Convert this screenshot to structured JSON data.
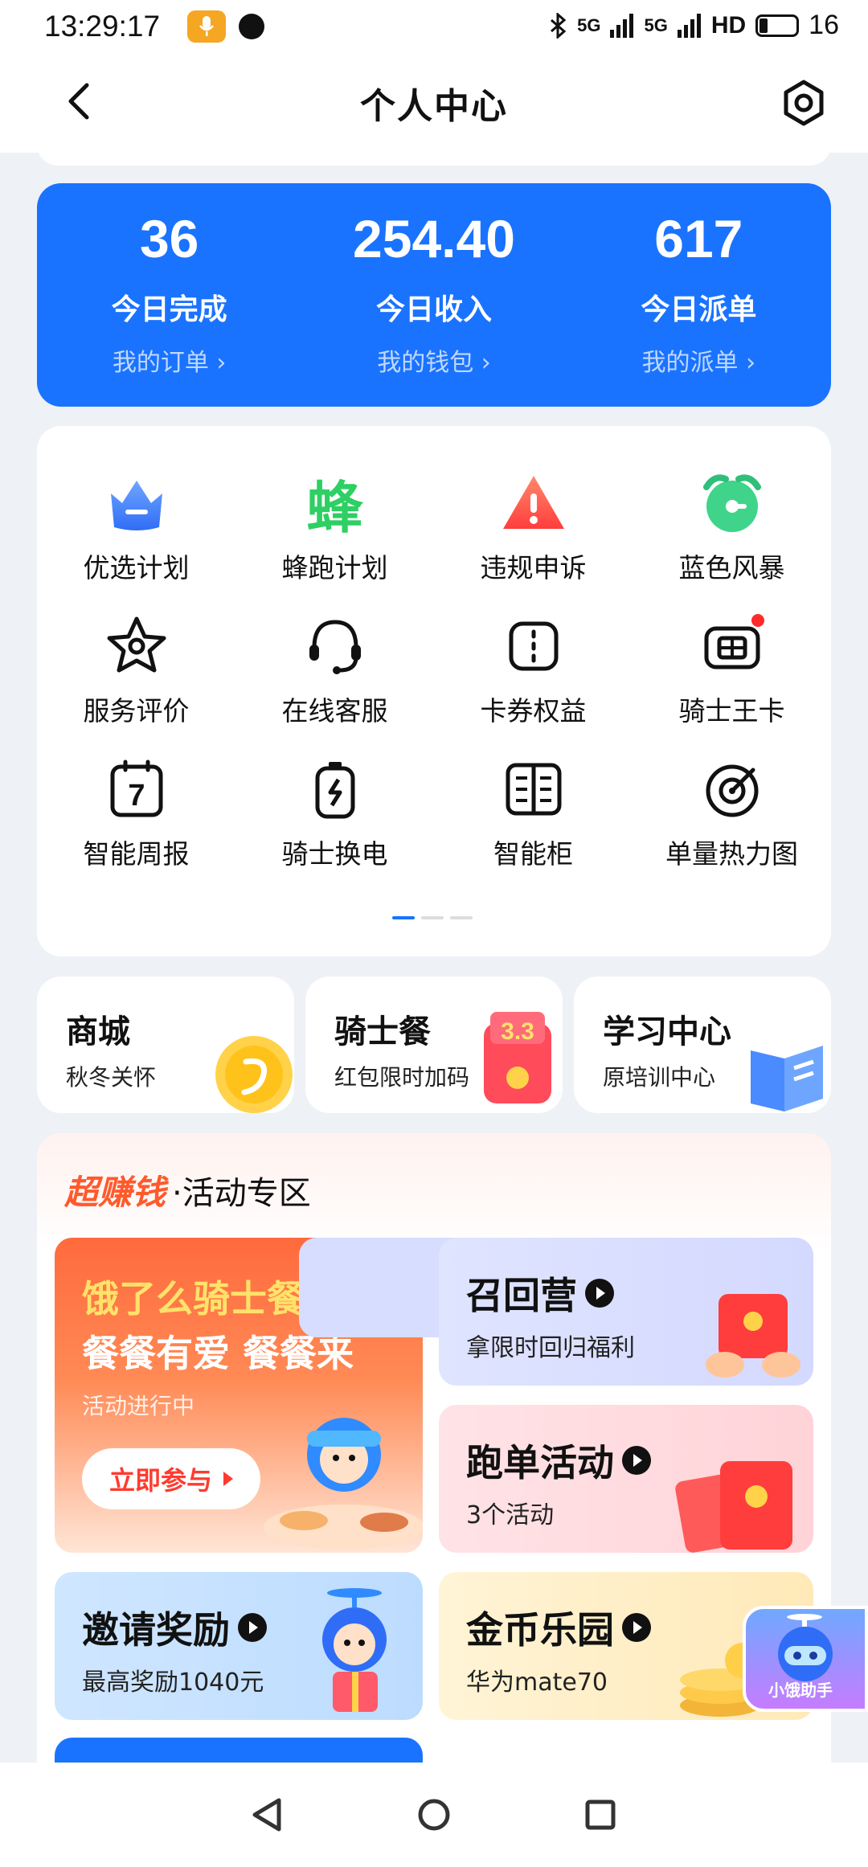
{
  "status_bar": {
    "time": "13:29:17",
    "signal1": "5G",
    "signal2": "5G",
    "hd": "HD",
    "battery": "16"
  },
  "header": {
    "title": "个人中心"
  },
  "stats": [
    {
      "value": "36",
      "label": "今日完成",
      "link": "我的订单 ›"
    },
    {
      "value": "254.40",
      "label": "今日收入",
      "link": "我的钱包 ›"
    },
    {
      "value": "617",
      "label": "今日派单",
      "link": "我的派单 ›"
    }
  ],
  "grid": [
    {
      "label": "优选计划",
      "icon": "crown-icon"
    },
    {
      "label": "蜂跑计划",
      "icon": "bee-character-icon",
      "glyph": "蜂"
    },
    {
      "label": "违规申诉",
      "icon": "warning-icon"
    },
    {
      "label": "蓝色风暴",
      "icon": "alarm-clock-icon"
    },
    {
      "label": "服务评价",
      "icon": "star-badge-icon"
    },
    {
      "label": "在线客服",
      "icon": "headset-icon"
    },
    {
      "label": "卡券权益",
      "icon": "coupon-icon"
    },
    {
      "label": "骑士王卡",
      "icon": "sim-card-icon",
      "badge": true
    },
    {
      "label": "智能周报",
      "icon": "calendar-7-icon",
      "glyph": "7"
    },
    {
      "label": "骑士换电",
      "icon": "battery-swap-icon"
    },
    {
      "label": "智能柜",
      "icon": "cabinet-icon"
    },
    {
      "label": "单量热力图",
      "icon": "target-icon"
    }
  ],
  "shortcuts": [
    {
      "title": "商城",
      "sub": "秋冬关怀"
    },
    {
      "title": "骑士餐",
      "sub": "红包限时加码"
    },
    {
      "title": "学习中心",
      "sub": "原培训中心"
    }
  ],
  "activity": {
    "brand": "超赚钱",
    "title": "·活动专区",
    "big": {
      "line1": "饿了么骑士餐",
      "line2": "餐餐有爱 餐餐来",
      "status": "活动进行中",
      "button": "立即参与"
    },
    "promos": [
      {
        "title": "召回营",
        "sub": "拿限时回归福利"
      },
      {
        "title": "跑单活动",
        "sub": "3个活动"
      },
      {
        "title": "邀请奖励",
        "sub": "最高奖励1040元"
      },
      {
        "title": "金币乐园",
        "sub": "华为mate70"
      }
    ]
  },
  "assistant": {
    "label": "小饿助手"
  },
  "colors": {
    "primary": "#1a73ff",
    "accent": "#ff5a2c",
    "badge": "#ff2b2b"
  }
}
